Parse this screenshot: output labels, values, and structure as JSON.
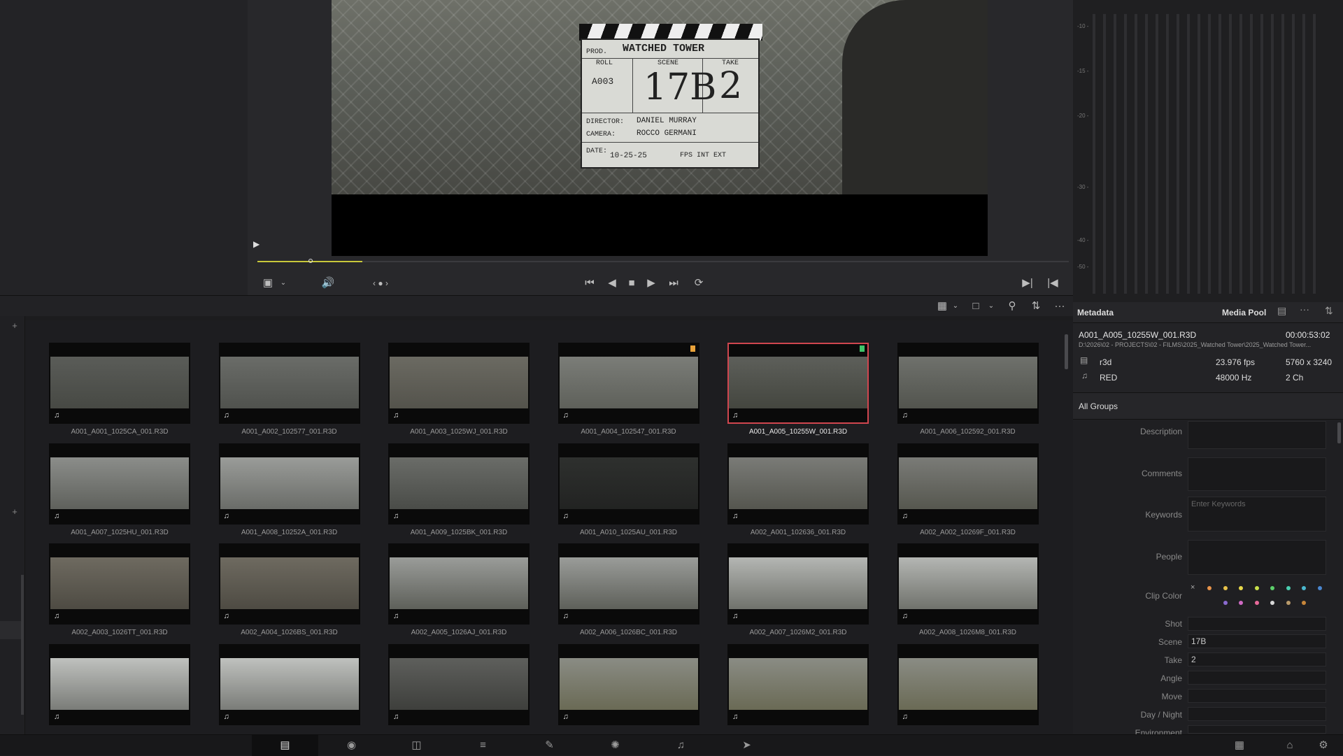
{
  "viewer": {
    "slate": {
      "title": "WATCHED TOWER",
      "prod": "PROD.",
      "roll_label": "ROLL",
      "scene_label": "SCENE",
      "take_label": "TAKE",
      "roll": "A003",
      "scene": "17B",
      "take": "2",
      "director_label": "DIRECTOR:",
      "director": "DANIEL MURRAY",
      "camera_label": "CAMERA:",
      "camera": "ROCCO GERMANI",
      "date_label": "DATE:",
      "date": "10-25-25",
      "options": "FPS  INT  EXT"
    }
  },
  "transport": {
    "buttons": [
      "first-frame",
      "prev-frame",
      "stop",
      "play",
      "last-frame",
      "loop"
    ]
  },
  "meters": {
    "scale": [
      "-10 -",
      "-15 -",
      "-20 -",
      "-30 -",
      "-40 -",
      "-50 -"
    ]
  },
  "media_pool": {
    "clips": [
      {
        "name": "A001_A001_1025CA_001.R3D",
        "flag": ""
      },
      {
        "name": "A001_A002_102577_001.R3D",
        "flag": ""
      },
      {
        "name": "A001_A003_1025WJ_001.R3D",
        "flag": ""
      },
      {
        "name": "A001_A004_102547_001.R3D",
        "flag": "#e8a13a"
      },
      {
        "name": "A001_A005_10255W_001.R3D",
        "flag": "#3fc46a",
        "selected": true
      },
      {
        "name": "A001_A006_102592_001.R3D",
        "flag": ""
      },
      {
        "name": "A001_A007_1025HU_001.R3D",
        "flag": ""
      },
      {
        "name": "A001_A008_10252A_001.R3D",
        "flag": ""
      },
      {
        "name": "A001_A009_1025BK_001.R3D",
        "flag": ""
      },
      {
        "name": "A001_A010_1025AU_001.R3D",
        "flag": ""
      },
      {
        "name": "A002_A001_102636_001.R3D",
        "flag": ""
      },
      {
        "name": "A002_A002_10269F_001.R3D",
        "flag": ""
      },
      {
        "name": "A002_A003_1026TT_001.R3D",
        "flag": ""
      },
      {
        "name": "A002_A004_1026BS_001.R3D",
        "flag": ""
      },
      {
        "name": "A002_A005_1026AJ_001.R3D",
        "flag": ""
      },
      {
        "name": "A002_A006_1026BC_001.R3D",
        "flag": ""
      },
      {
        "name": "A002_A007_1026M2_001.R3D",
        "flag": ""
      },
      {
        "name": "A002_A008_1026M8_001.R3D",
        "flag": ""
      },
      {
        "name": "",
        "flag": ""
      },
      {
        "name": "",
        "flag": ""
      },
      {
        "name": "",
        "flag": ""
      },
      {
        "name": "",
        "flag": ""
      },
      {
        "name": "",
        "flag": ""
      },
      {
        "name": "",
        "flag": ""
      }
    ]
  },
  "metadata": {
    "tab_metadata": "Metadata",
    "tab_media_pool": "Media Pool",
    "clip_name": "A001_A005_10255W_001.R3D",
    "duration": "00:00:53:02",
    "path": "D:\\2026\\02 - PROJECTS\\02 - FILMS\\2025_Watched Tower\\2025_Watched Tower...",
    "video_format": "r3d",
    "fps": "23.976 fps",
    "resolution": "5760 x 3240",
    "audio_format": "RED",
    "sample_rate": "48000 Hz",
    "channels": "2 Ch",
    "group": "All Groups",
    "fields": {
      "description_label": "Description",
      "comments_label": "Comments",
      "keywords_label": "Keywords",
      "keywords_placeholder": "Enter Keywords",
      "people_label": "People",
      "clip_color_label": "Clip Color",
      "shot_label": "Shot",
      "shot": "",
      "scene_label": "Scene",
      "scene": "17B",
      "take_label": "Take",
      "take": "2",
      "angle_label": "Angle",
      "angle": "",
      "move_label": "Move",
      "move": "",
      "daynight_label": "Day / Night",
      "daynight": "",
      "environment_label": "Environment"
    },
    "clip_colors": [
      "#e8934a",
      "#e8c24a",
      "#e8d84a",
      "#c8e04a",
      "#5ccf6a",
      "#4acfb0",
      "#4ab8cf",
      "#4a86cf",
      "#8a6acf",
      "#cf6ac4",
      "#e86a9a",
      "#d8d8d8",
      "#b89a6a",
      "#c8863a"
    ]
  },
  "bottom_pages": [
    "media",
    "cut",
    "edit",
    "fusion",
    "color",
    "fairlight",
    "deliver"
  ]
}
